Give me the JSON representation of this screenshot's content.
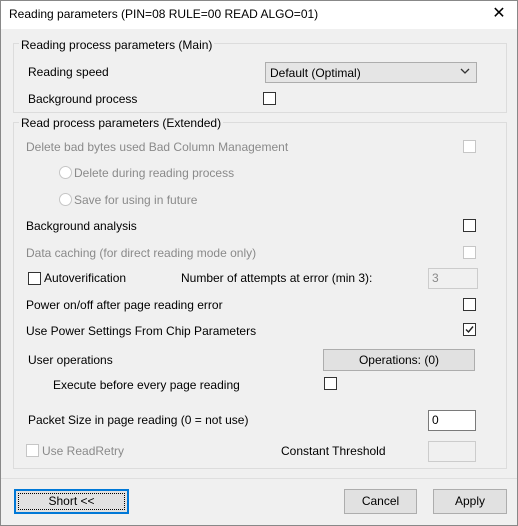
{
  "window": {
    "title": "Reading parameters (PIN=08 RULE=00 READ ALGO=01)",
    "close_glyph": "✕"
  },
  "main_group": {
    "title": "Reading process parameters (Main)",
    "reading_speed_label": "Reading speed",
    "reading_speed_value": "Default (Optimal)",
    "background_process_label": "Background process"
  },
  "ext_group": {
    "title": "Read process parameters (Extended)",
    "delete_bad_bytes_label": "Delete bad bytes used Bad Column Management",
    "delete_during_label": "Delete during reading process",
    "save_for_future_label": "Save for using in future",
    "background_analysis_label": "Background analysis",
    "data_caching_label": "Data caching (for direct reading mode only)",
    "autoverification_label": "Autoverification",
    "attempts_label": "Number of attempts at error (min 3):",
    "attempts_value": "3",
    "power_onoff_label": "Power on/off after page reading error",
    "use_power_settings_label": "Use Power Settings From Chip Parameters",
    "use_power_settings_checked": true,
    "user_operations_label": "User operations",
    "operations_button": "Operations: (0)",
    "execute_before_label": "Execute before every page reading",
    "packet_size_label": "Packet Size in page reading (0 = not use)",
    "packet_size_value": "0",
    "use_readretry_label": "Use ReadRetry",
    "constant_threshold_label": "Constant Threshold",
    "constant_threshold_value": ""
  },
  "footer": {
    "short_button": "Short <<",
    "cancel_button": "Cancel",
    "apply_button": "Apply"
  }
}
